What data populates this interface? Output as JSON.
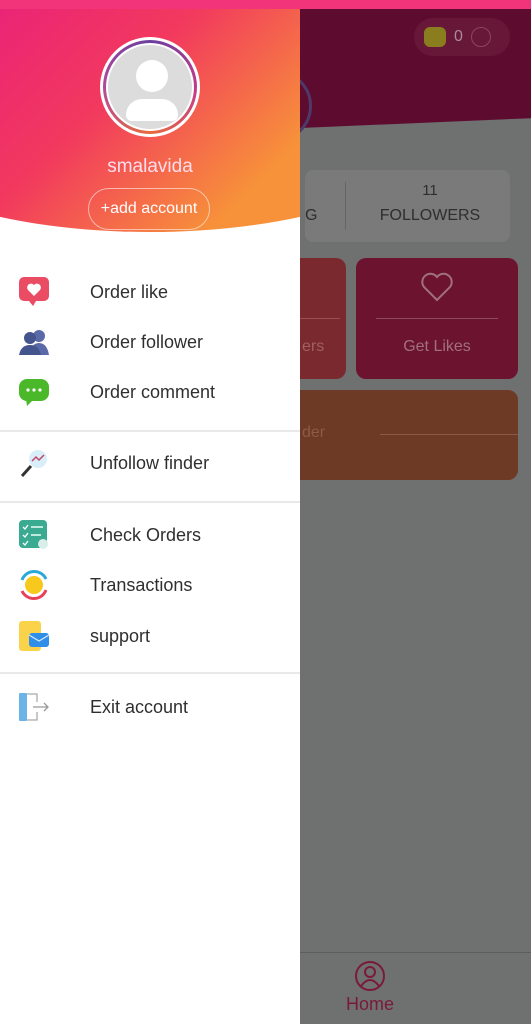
{
  "background_app": {
    "coins": "0",
    "stats": {
      "following_partial": "G",
      "followers_count": "11",
      "followers_label": "FOLLOWERS"
    },
    "cards": {
      "followers_partial": "ers",
      "get_likes": "Get Likes",
      "order_partial": "der"
    },
    "bottom_nav": {
      "home": "Home"
    }
  },
  "drawer": {
    "username": "smalavida",
    "add_account": "+add account",
    "items": [
      {
        "label": "Order like",
        "icon": "heart-bubble-icon"
      },
      {
        "label": "Order follower",
        "icon": "users-icon"
      },
      {
        "label": "Order comment",
        "icon": "comment-icon"
      },
      {
        "label": "Unfollow finder",
        "icon": "magnifier-chart-icon"
      },
      {
        "label": "Check Orders",
        "icon": "checklist-icon"
      },
      {
        "label": "Transactions",
        "icon": "coin-exchange-icon"
      },
      {
        "label": "support",
        "icon": "folder-mail-icon"
      },
      {
        "label": "Exit account",
        "icon": "exit-door-icon"
      }
    ]
  },
  "colors": {
    "accent_pink": "#e71a82",
    "accent_orange": "#f7913a",
    "overlay": "#6f7070"
  }
}
